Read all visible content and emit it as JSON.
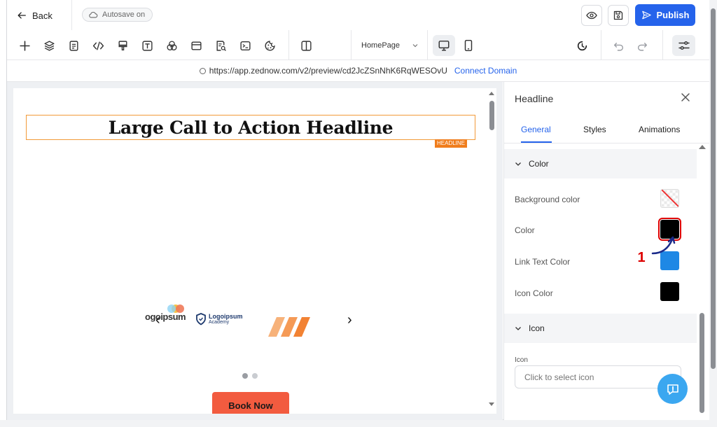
{
  "header": {
    "back_label": "Back",
    "autosave_label": "Autosave on",
    "publish_label": "Publish"
  },
  "toolbar": {
    "page_select_value": "HomePage"
  },
  "urlbar": {
    "url": "https://app.zednow.com/v2/preview/cd2JcZSnNhK6RqWESOvU",
    "connect_label": "Connect Domain"
  },
  "canvas": {
    "headline": "Large Call to Action Headline",
    "headline_tag": "HEADLINE",
    "logos": {
      "logo1": "ogoipsum",
      "logo2_name": "Logoipsum",
      "logo2_sub": "Academy"
    },
    "cta_label": "Book Now"
  },
  "panel": {
    "title": "Headline",
    "tabs": [
      "General",
      "Styles",
      "Animations"
    ],
    "color_section": "Color",
    "rows": {
      "background_color": "Background color",
      "color": "Color",
      "link_text_color": "Link Text Color",
      "icon_color": "Icon Color"
    },
    "swatches": {
      "color": "#000000",
      "link_text_color": "#1e88e5",
      "icon_color": "#000000"
    },
    "icon_section": "Icon",
    "icon_field_label": "Icon",
    "icon_placeholder": "Click to select icon"
  },
  "annotation": {
    "step": "1"
  },
  "colors": {
    "accent": "#2563eb",
    "headline_outline": "#f29a38",
    "cta": "#f25b3f",
    "annotation": "#d00000"
  }
}
